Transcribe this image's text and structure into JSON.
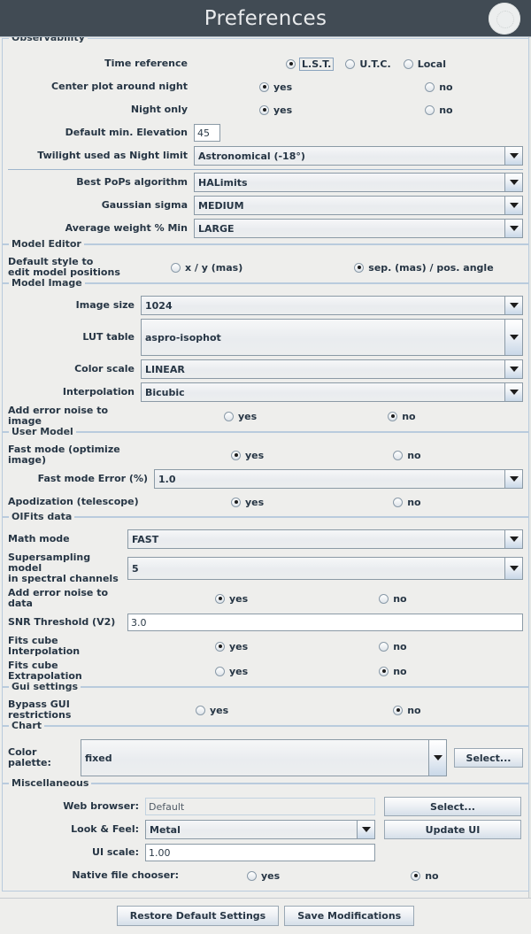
{
  "window": {
    "title": "Preferences",
    "avatar_icon": "user-avatar-icon"
  },
  "sections": {
    "observability": {
      "legend": "Observability",
      "time_reference": {
        "label": "Time reference",
        "options": [
          "L.S.T.",
          "U.T.C.",
          "Local"
        ],
        "selected": "L.S.T."
      },
      "center_plot": {
        "label": "Center plot around night",
        "yes": "yes",
        "no": "no",
        "selected": "yes"
      },
      "night_only": {
        "label": "Night only",
        "yes": "yes",
        "no": "no",
        "selected": "yes"
      },
      "min_elevation": {
        "label": "Default min. Elevation",
        "value": "45"
      },
      "twilight": {
        "label": "Twilight used as Night limit",
        "value": "Astronomical (-18°)"
      },
      "pops_algorithm": {
        "label": "Best PoPs algorithm",
        "value": "HALimits"
      },
      "gaussian_sigma": {
        "label": "Gaussian sigma",
        "value": "MEDIUM"
      },
      "average_weight": {
        "label": "Average weight % Min",
        "value": "LARGE"
      }
    },
    "model_editor": {
      "legend": "Model Editor",
      "default_style": {
        "label_line1": "Default style to",
        "label_line2": "edit model positions",
        "option_a": "x / y (mas)",
        "option_b": "sep. (mas) / pos. angle",
        "selected": "sep. (mas) / pos. angle"
      }
    },
    "model_image": {
      "legend": "Model Image",
      "image_size": {
        "label": "Image size",
        "value": "1024"
      },
      "lut_table": {
        "label": "LUT table",
        "value": "aspro-isophot"
      },
      "color_scale": {
        "label": "Color scale",
        "value": "LINEAR"
      },
      "interpolation": {
        "label": "Interpolation",
        "value": "Bicubic"
      },
      "add_error_noise": {
        "label": "Add error noise to image",
        "yes": "yes",
        "no": "no",
        "selected": "no"
      }
    },
    "user_model": {
      "legend": "User Model",
      "fast_mode": {
        "label": "Fast mode (optimize image)",
        "yes": "yes",
        "no": "no",
        "selected": "yes"
      },
      "fast_mode_error": {
        "label": "Fast mode Error (%)",
        "value": "1.0"
      },
      "apodization": {
        "label": "Apodization (telescope)",
        "yes": "yes",
        "no": "no",
        "selected": "yes"
      }
    },
    "oifits_data": {
      "legend": "OIFits data",
      "math_mode": {
        "label": "Math mode",
        "value": "FAST"
      },
      "supersampling": {
        "label_line1": "Supersampling model",
        "label_line2": "in spectral channels",
        "value": "5"
      },
      "add_error_noise": {
        "label": "Add error noise to data",
        "yes": "yes",
        "no": "no",
        "selected": "yes"
      },
      "snr_threshold": {
        "label": "SNR Threshold (V2)",
        "value": "3.0"
      },
      "fits_interpolation": {
        "label": "Fits cube Interpolation",
        "yes": "yes",
        "no": "no",
        "selected": "yes"
      },
      "fits_extrapolation": {
        "label": "Fits cube Extrapolation",
        "yes": "yes",
        "no": "no",
        "selected": "no"
      }
    },
    "gui_settings": {
      "legend": "Gui settings",
      "bypass": {
        "label": "Bypass GUI restrictions",
        "yes": "yes",
        "no": "no",
        "selected": "no"
      }
    },
    "chart": {
      "legend": "Chart",
      "color_palette": {
        "label": "Color palette:",
        "value": "fixed",
        "select_button": "Select..."
      }
    },
    "miscellaneous": {
      "legend": "Miscellaneous",
      "web_browser": {
        "label": "Web browser:",
        "value": "Default",
        "select_button": "Select..."
      },
      "look_and_feel": {
        "label": "Look & Feel:",
        "value": "Metal",
        "update_button": "Update UI"
      },
      "ui_scale": {
        "label": "UI scale:",
        "value": "1.00"
      },
      "native_file_chooser": {
        "label": "Native file chooser:",
        "yes": "yes",
        "no": "no",
        "selected": "no"
      }
    }
  },
  "footer": {
    "restore_label": "Restore Default Settings",
    "save_label": "Save Modifications"
  },
  "colors": {
    "titlebar": "#414b54",
    "background": "#eeeeec",
    "group_border": "#b9cbdd",
    "text": "#263544"
  }
}
